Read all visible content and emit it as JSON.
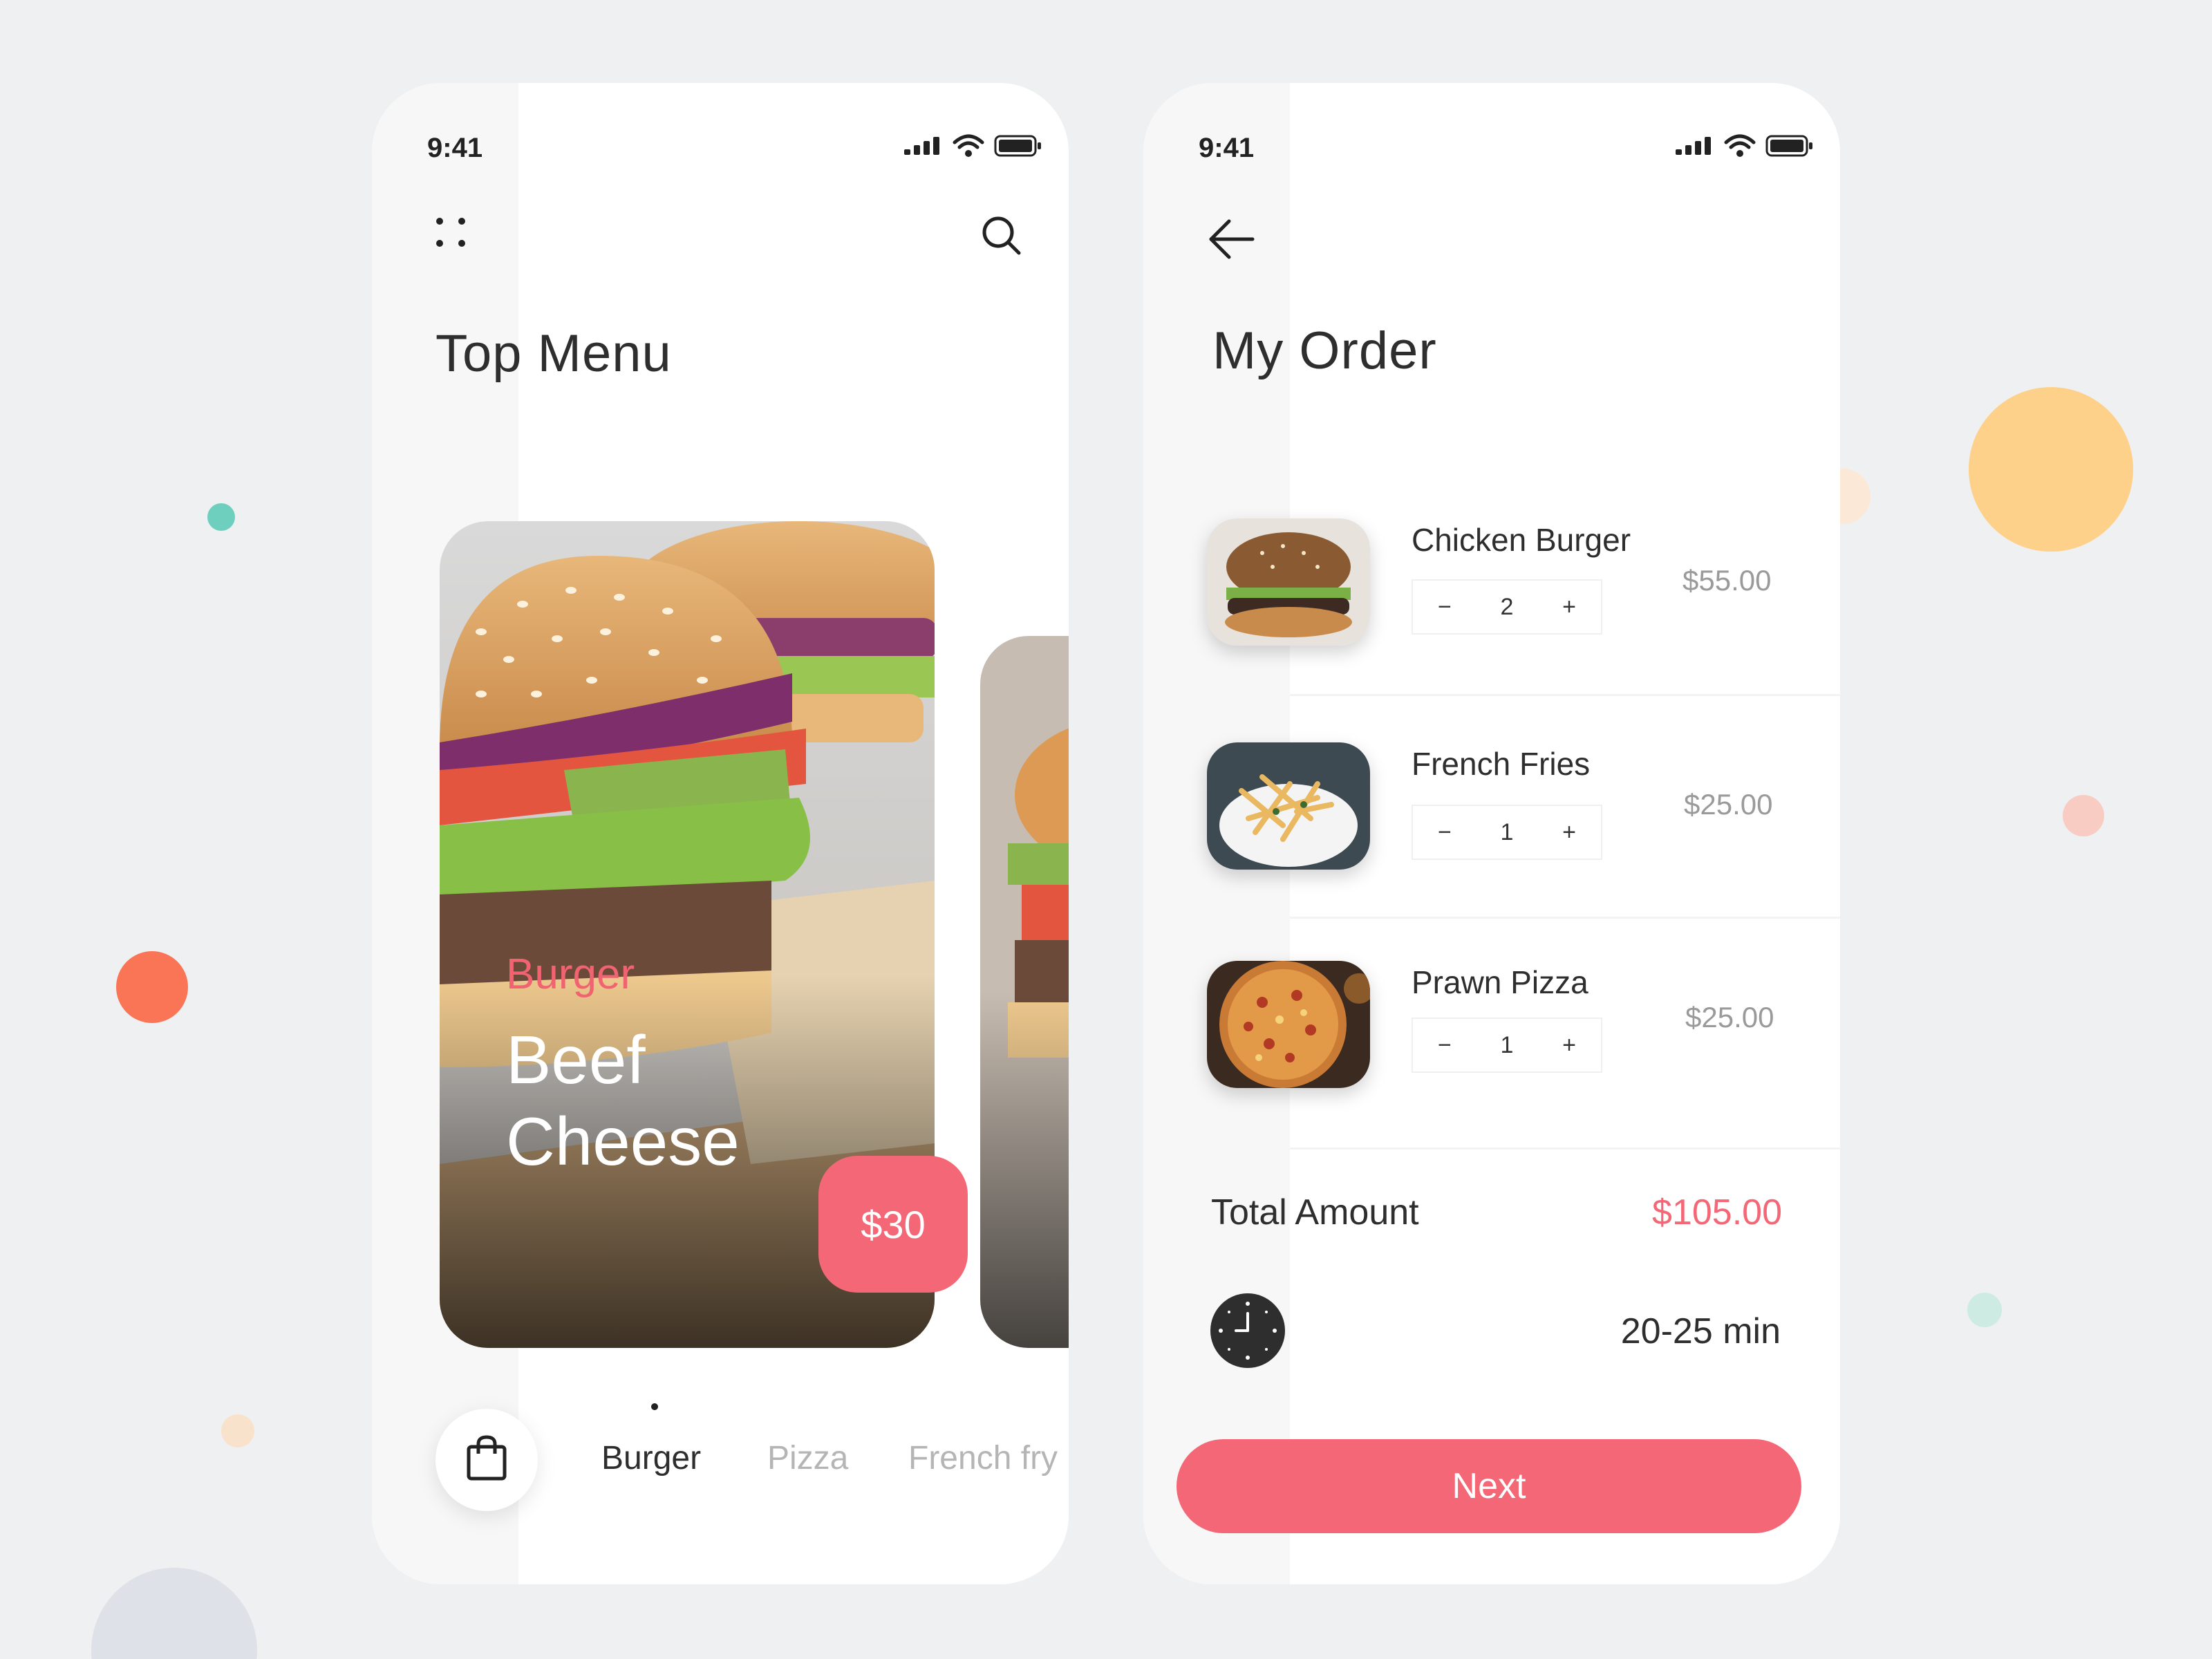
{
  "colors": {
    "accent": "#f46776",
    "background": "#eef0f2",
    "text": "#2e2e2e",
    "muted": "#9a9a9a"
  },
  "left_screen": {
    "status_time": "9:41",
    "menu_icon": "grid-dots-icon",
    "search_icon": "search-icon",
    "title": "Top Menu",
    "card": {
      "category": "Burger",
      "name_line1": "Beef",
      "name_line2": "Cheese",
      "price": "$30"
    },
    "bag_icon": "shopping-bag-icon",
    "categories": [
      {
        "label": "Burger",
        "active": true
      },
      {
        "label": "Pizza",
        "active": false
      },
      {
        "label": "French fry",
        "active": false
      }
    ]
  },
  "right_screen": {
    "status_time": "9:41",
    "back_icon": "arrow-left-icon",
    "title": "My Order",
    "items": [
      {
        "name": "Chicken Burger",
        "qty": "2",
        "price": "$55.00",
        "minus": "−",
        "plus": "+"
      },
      {
        "name": "French Fries",
        "qty": "1",
        "price": "$25.00",
        "minus": "−",
        "plus": "+"
      },
      {
        "name": "Prawn Pizza",
        "qty": "1",
        "price": "$25.00",
        "minus": "−",
        "plus": "+"
      }
    ],
    "total_label": "Total Amount",
    "total_value": "$105.00",
    "clock_icon": "clock-icon",
    "delivery_time": "20-25 min",
    "next_label": "Next"
  }
}
